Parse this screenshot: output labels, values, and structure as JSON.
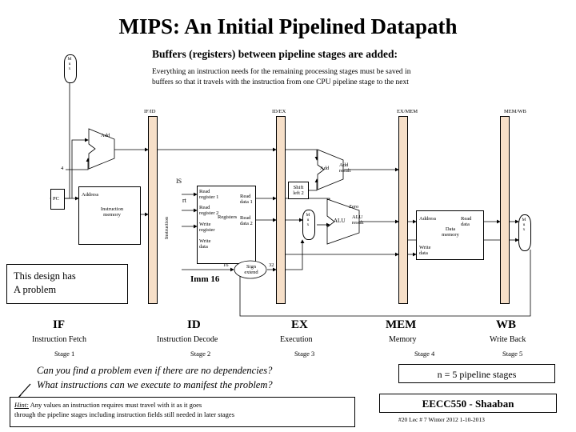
{
  "title": "MIPS:  An Initial Pipelined Datapath",
  "header": {
    "line1": "Buffers (registers) between pipeline stages are added:",
    "line2": "Everything an instruction needs for the remaining processing stages must be saved in",
    "line3": "buffers so that it travels with the instruction from one CPU pipeline stage to the next"
  },
  "buffers": [
    {
      "id": "IF/ID"
    },
    {
      "id": "ID/EX"
    },
    {
      "id": "EX/MEM"
    },
    {
      "id": "MEM/WB"
    }
  ],
  "diagram": {
    "pc_mux_label": "M\nu\nx",
    "pc": "PC",
    "address_if": "Address",
    "instruction_memory": "Instruction\nmemory",
    "instruction_buf_label": "Instruction",
    "add_top": "Add",
    "const4": "4",
    "add_ex": "Add",
    "add_result": "Add\nresult",
    "shift_left2": "Shift\nleft 2",
    "is_label": "IS",
    "rt_label": "rt",
    "read_register1": "Read\nregister 1",
    "read_register2": "Read\nregister 2",
    "write_register": "Write\nregister",
    "write_data_reg": "Write\ndata",
    "registers": "Registers",
    "read_data1": "Read\ndata 1",
    "read_data2": "Read\ndata 2",
    "imm16": "Imm 16",
    "sixteen": "16",
    "thirtytwo": "32",
    "sign_extend": "Sign\nextend",
    "alu_mux_label": "M\nu\nx",
    "alu": "ALU",
    "zero": "Zero",
    "alu_result": "ALU\nresult",
    "mem_address": "Address",
    "data_memory": "Data\nmemory",
    "mem_read_data": "Read\ndata",
    "mem_write_data": "Write\ndata",
    "wb_mux_label": "M\nu\nx"
  },
  "problem_note": {
    "line1": "This design has",
    "line2": "A problem"
  },
  "stages": [
    {
      "name": "IF",
      "sub": "Instruction Fetch",
      "num": "Stage 1"
    },
    {
      "name": "ID",
      "sub": "Instruction Decode",
      "num": "Stage 2"
    },
    {
      "name": "EX",
      "sub": "Execution",
      "num": "Stage 3"
    },
    {
      "name": "MEM",
      "sub": "Memory",
      "num": "Stage 4"
    },
    {
      "name": "WB",
      "sub": "Write Back",
      "num": "Stage 5"
    }
  ],
  "questions": {
    "q1": "Can you find a problem even if there are no dependencies?",
    "q2": "What instructions can we execute to manifest the problem?"
  },
  "hint": {
    "label": "Hint:",
    "line1": "Any values an instruction requires must travel with it as it goes",
    "line2": "through the pipeline stages including instruction fields still needed in later stages"
  },
  "n_stages": "n = 5 pipeline stages",
  "course": "EECC550 - Shaaban",
  "footer": "#20   Lec # 7  Winter 2012  1-10-2013"
}
